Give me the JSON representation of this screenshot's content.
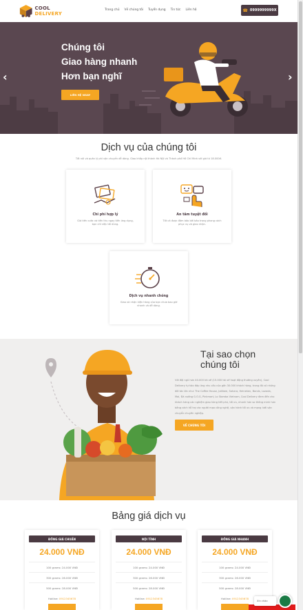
{
  "header": {
    "logo_line1": "COOL",
    "logo_line2": "DELIVERY",
    "nav": [
      "Trang chủ",
      "Về chúng tôi",
      "Tuyển dụng",
      "Tin tức",
      "Liên hệ"
    ],
    "phone": "0999999999X"
  },
  "hero": {
    "line1": "Chúng tôi",
    "line2": "Giao hàng nhanh",
    "line3": "Hơn bạn nghĩ",
    "cta": "LIÊN HỆ NGAY"
  },
  "services": {
    "title": "Dịch vụ của chúng tôi",
    "subtitle": "Tốt nói và quân lý phí vận chuyển dễ dàng. Giao khắp nội thành Hà Nội và Thành phố Hồ Chí Minh với giá từ 18.000đ.",
    "cards": [
      {
        "title": "Chi phí hợp lý",
        "desc": "Giá tiền cước và tiền thu ngay tiền ứng dụng, bạn chỉ việc tối dùng."
      },
      {
        "title": "An tâm tuyệt đối",
        "desc": "Tất cả được đảm bảo bởi bảo trong phong cách phục vụ và giao nhận."
      },
      {
        "title": "Dịch vụ nhanh chóng",
        "desc": "Giao và nhận kiện hàng của bạn chưa bao giờ nhanh và dễ dàng."
      }
    ]
  },
  "why": {
    "title_l1": "Tại sao chọn",
    "title_l2": "chúng tôi",
    "text": "Với đội ngũ hơn 40.000 tài xế (15.000 tài xế hoạt động thường xuyên), Cool Delivery tự hào đáp ứng nhu cầu của gần 30.000 khách hàng, trong đó có những đối tác lớn như: The Coffee House, Jollibee, Sahara, Heineken, Bonds, Lazada, Mai, Đà nướng G.O.G, Pinkmart, Lo Stamba Vietnam, Cool Delivery đem đến cho khách hàng các nghiệm giao hàng tiết phú, tối ưu, nhanh hơn so thông minh hơn bằng cách hỗ trợ các người mạo công nghệ, vận hành tối ưu và mạng lưới vận chuyển chuyên nghiệp.",
    "cta": "VỀ CHÚNG TÔI"
  },
  "pricing": {
    "title": "Bảng giá dịch vụ",
    "plans": [
      {
        "name": "ĐỒNG GIÁ CHUẨN",
        "price": "24.000 VNĐ",
        "rows": [
          "100 grams: 24.000 VNĐ",
          "300 grams: 26.000 VNĐ",
          "500 grams: 28.000 VNĐ"
        ],
        "hotline_label": "Hotline:",
        "hotline": "0912345678"
      },
      {
        "name": "NỘI TỈNH",
        "price": "24.000 VNĐ",
        "rows": [
          "100 grams: 24.000 VNĐ",
          "300 grams: 26.000 VNĐ",
          "500 grams: 28.000 VNĐ"
        ],
        "hotline_label": "Hotline:",
        "hotline": "0912345678"
      },
      {
        "name": "ĐỒNG GIÁ NHANH",
        "price": "24.000 VNĐ",
        "rows": [
          "100 grams: 24.000 VNĐ",
          "300 grams: 26.000 VNĐ",
          "500 grams: 28.000 VNĐ"
        ],
        "hotline_label": "Hotline:",
        "hotline": "0912345678"
      }
    ]
  },
  "chat": {
    "label": "Xin chào"
  },
  "colors": {
    "primary": "#f5a623",
    "dark": "#4a3a42",
    "hero_bg": "#5a4750"
  }
}
